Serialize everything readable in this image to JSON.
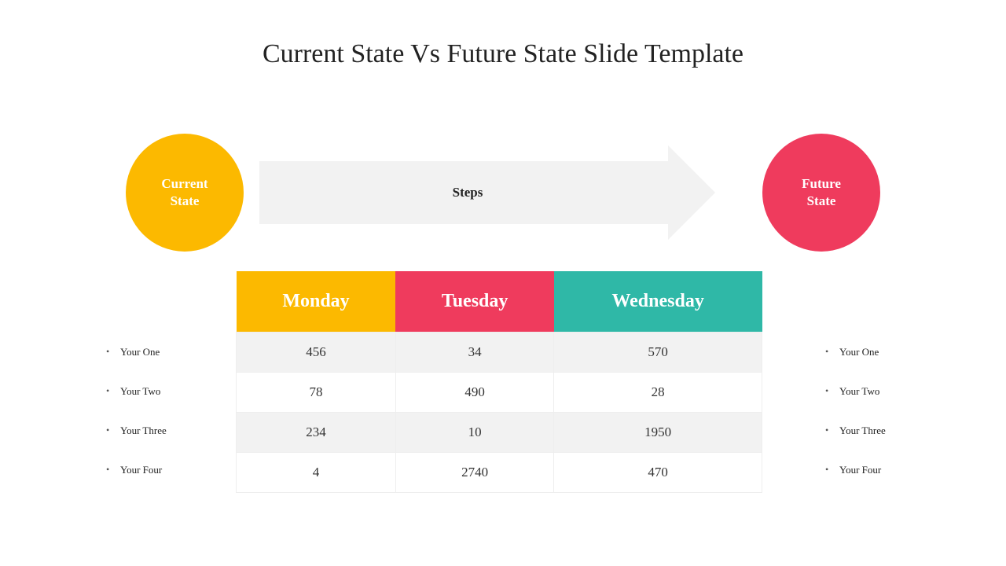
{
  "title": "Current State Vs Future State Slide Template",
  "current_circle": "Current\nState",
  "future_circle": "Future\nState",
  "arrow_label": "Steps",
  "colors": {
    "yellow": "#fcb900",
    "pink": "#ef3b5d",
    "teal": "#2fb8a7",
    "light": "#f2f2f2"
  },
  "left_list": [
    "Your One",
    "Your Two",
    "Your Three",
    "Your Four"
  ],
  "right_list": [
    "Your One",
    "Your Two",
    "Your Three",
    "Your Four"
  ],
  "chart_data": {
    "type": "table",
    "headers": [
      "Monday",
      "Tuesday",
      "Wednesday"
    ],
    "rows": [
      [
        456,
        34,
        570
      ],
      [
        78,
        490,
        28
      ],
      [
        234,
        10,
        1950
      ],
      [
        4,
        2740,
        470
      ]
    ]
  }
}
